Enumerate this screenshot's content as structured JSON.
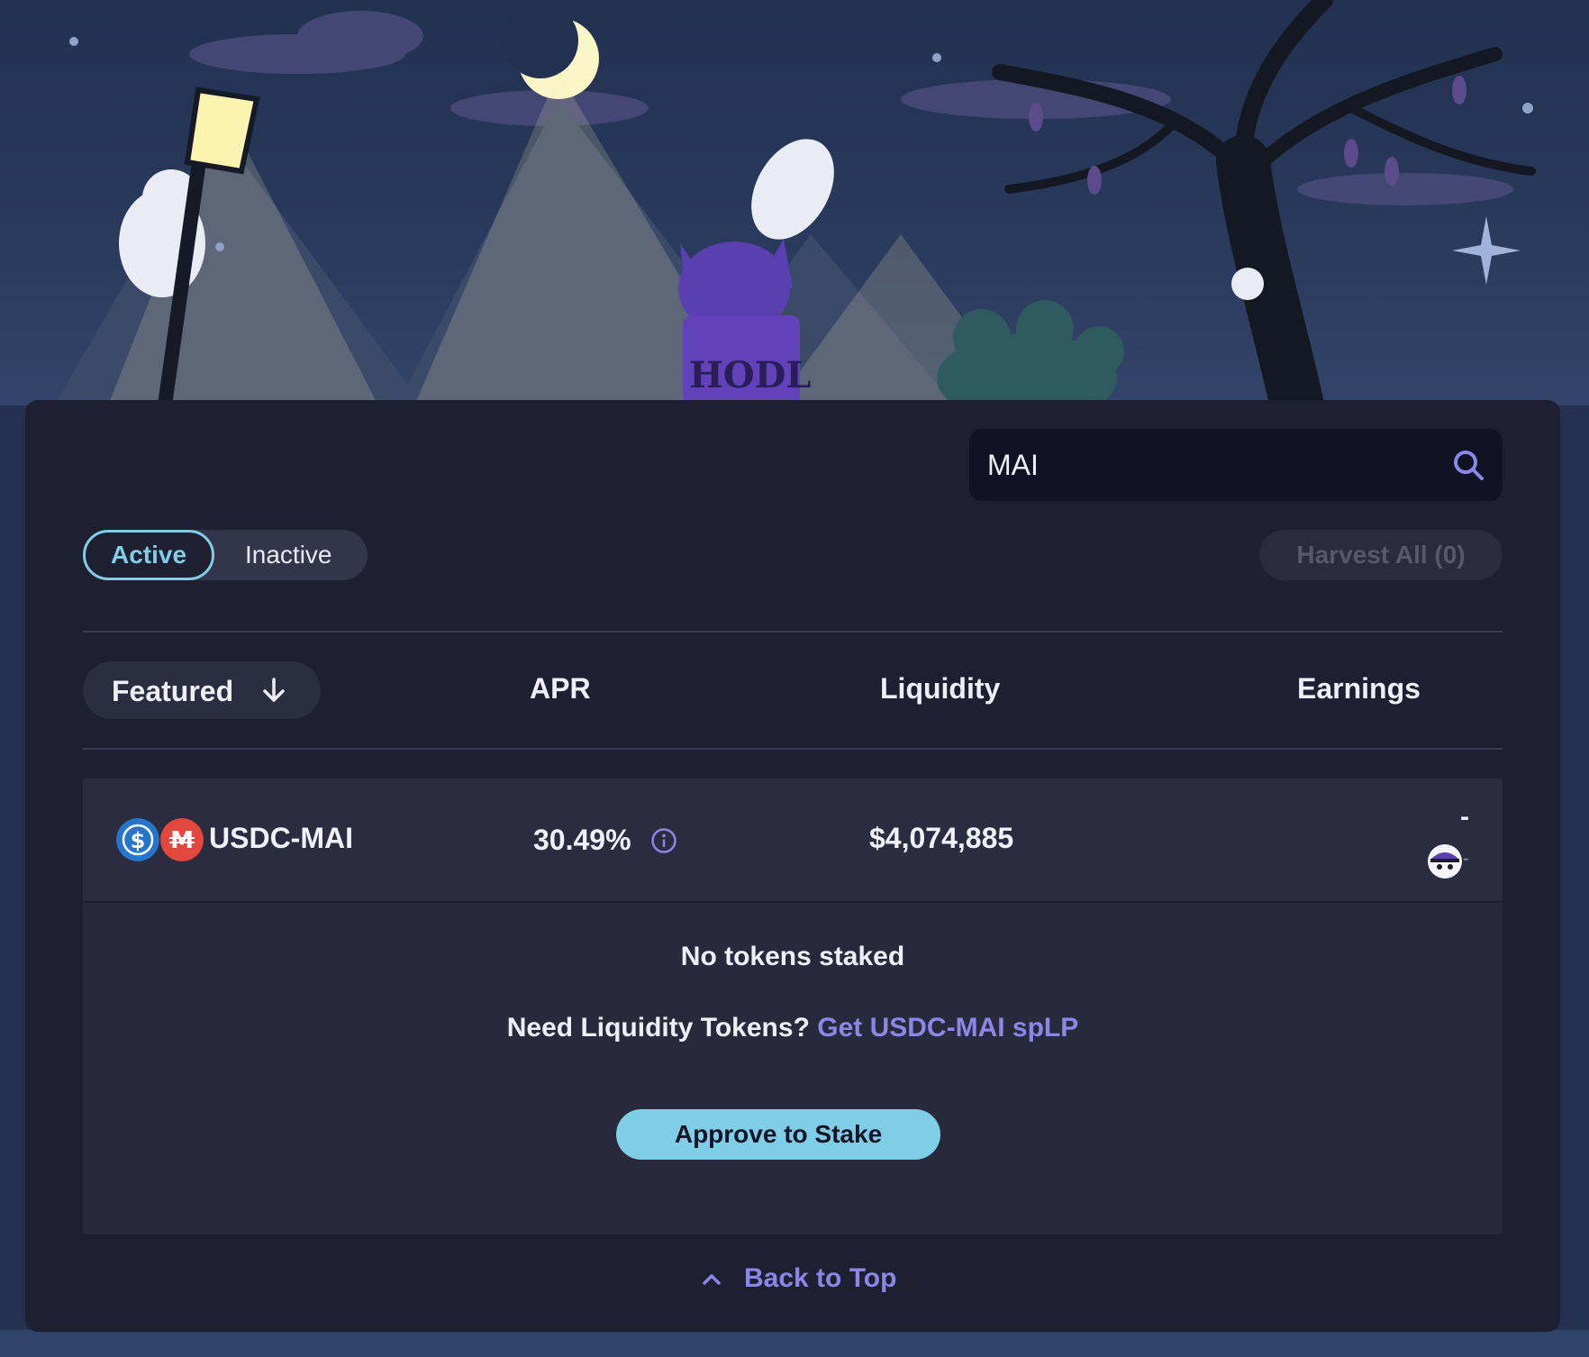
{
  "search": {
    "value": "MAI"
  },
  "filters": {
    "active_label": "Active",
    "inactive_label": "Inactive",
    "harvest_label": "Harvest All (0)"
  },
  "table": {
    "sort_label": "Featured",
    "headers": {
      "apr": "APR",
      "liquidity": "Liquidity",
      "earnings": "Earnings"
    },
    "row": {
      "pair": "USDC-MAI",
      "token_icons": [
        "usdc-icon",
        "mai-icon"
      ],
      "apr": "30.49%",
      "liquidity": "$4,074,885",
      "earnings_main": "-",
      "earnings_sub": "-"
    }
  },
  "details": {
    "status": "No tokens staked",
    "need_text": "Need Liquidity Tokens?",
    "get_link": "Get USDC-MAI spLP",
    "approve_label": "Approve to Stake"
  },
  "footer": {
    "back_to_top": "Back to Top"
  },
  "colors": {
    "accent": "#7fcde6",
    "link": "#8b86e8",
    "panel": "#1e1f31",
    "usdc": "#2775ca",
    "mai": "#e2483d"
  }
}
